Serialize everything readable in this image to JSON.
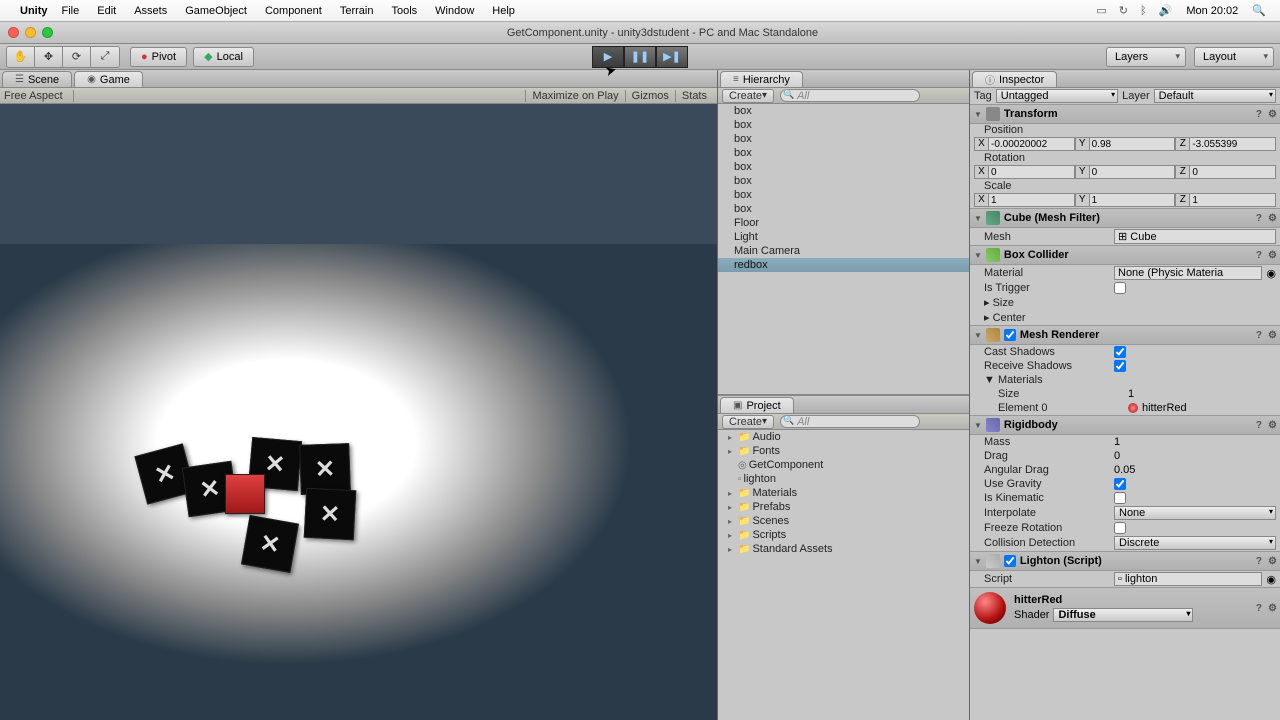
{
  "menubar": {
    "app": "Unity",
    "items": [
      "File",
      "Edit",
      "Assets",
      "GameObject",
      "Component",
      "Terrain",
      "Tools",
      "Window",
      "Help"
    ],
    "clock": "Mon 20:02"
  },
  "window_title": "GetComponent.unity - unity3dstudent - PC and Mac Standalone",
  "toolbar": {
    "pivot": "Pivot",
    "local": "Local",
    "layers": "Layers",
    "layout": "Layout"
  },
  "tabs": {
    "scene": "Scene",
    "game": "Game",
    "hierarchy": "Hierarchy",
    "project": "Project",
    "inspector": "Inspector"
  },
  "gamebar": {
    "aspect": "Free Aspect",
    "maximize": "Maximize on Play",
    "gizmos": "Gizmos",
    "stats": "Stats"
  },
  "hierarchy": {
    "create": "Create",
    "search_placeholder": "All",
    "items": [
      "box",
      "box",
      "box",
      "box",
      "box",
      "box",
      "box",
      "box",
      "Floor",
      "Light",
      "Main Camera",
      "redbox"
    ],
    "selected": "redbox"
  },
  "project": {
    "create": "Create",
    "search_placeholder": "All",
    "folders": [
      "Audio",
      "Fonts"
    ],
    "assets": [
      "GetComponent",
      "lighton"
    ],
    "folders2": [
      "Materials",
      "Prefabs",
      "Scenes",
      "Scripts",
      "Standard Assets"
    ]
  },
  "inspector": {
    "tag_label": "Tag",
    "tag_value": "Untagged",
    "layer_label": "Layer",
    "layer_value": "Default",
    "transform": {
      "title": "Transform",
      "position_label": "Position",
      "position": {
        "x": "-0.00020002",
        "y": "0.98",
        "z": "-3.055399"
      },
      "rotation_label": "Rotation",
      "rotation": {
        "x": "0",
        "y": "0",
        "z": "0"
      },
      "scale_label": "Scale",
      "scale": {
        "x": "1",
        "y": "1",
        "z": "1"
      }
    },
    "meshfilter": {
      "title": "Cube (Mesh Filter)",
      "mesh_label": "Mesh",
      "mesh_value": "Cube"
    },
    "collider": {
      "title": "Box Collider",
      "material_label": "Material",
      "material_value": "None (Physic Materia",
      "trigger_label": "Is Trigger",
      "size_label": "Size",
      "center_label": "Center"
    },
    "renderer": {
      "title": "Mesh Renderer",
      "cast_label": "Cast Shadows",
      "receive_label": "Receive Shadows",
      "materials_label": "Materials",
      "size_label": "Size",
      "size_value": "1",
      "element_label": "Element 0",
      "element_value": "hitterRed"
    },
    "rigidbody": {
      "title": "Rigidbody",
      "mass_label": "Mass",
      "mass_value": "1",
      "drag_label": "Drag",
      "drag_value": "0",
      "angdrag_label": "Angular Drag",
      "angdrag_value": "0.05",
      "gravity_label": "Use Gravity",
      "kinematic_label": "Is Kinematic",
      "interp_label": "Interpolate",
      "interp_value": "None",
      "freeze_label": "Freeze Rotation",
      "colldet_label": "Collision Detection",
      "colldet_value": "Discrete"
    },
    "script": {
      "title": "Lighton (Script)",
      "script_label": "Script",
      "script_value": "lighton"
    },
    "material": {
      "name": "hitterRed",
      "shader_label": "Shader",
      "shader_value": "Diffuse"
    }
  }
}
